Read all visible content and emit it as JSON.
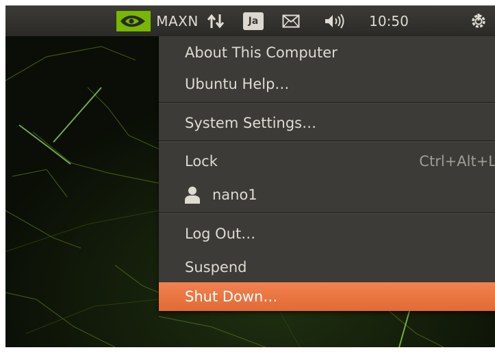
{
  "panel": {
    "nvidia_indicator_icon": "nvidia-logo-icon",
    "power_mode": "MAXN",
    "network_icon": "network-arrows-icon",
    "keyboard_layout": "Ja",
    "mail_icon": "envelope-icon",
    "sound_icon": "speaker-icon",
    "clock": "10:50",
    "session_icon": "gear-power-icon"
  },
  "menu": {
    "about": "About This Computer",
    "help": "Ubuntu Help…",
    "settings": "System Settings…",
    "lock": "Lock",
    "lock_shortcut": "Ctrl+Alt+L",
    "user_icon": "user-icon",
    "user": "nano1",
    "logout": "Log Out…",
    "suspend": "Suspend",
    "shutdown": "Shut Down…"
  },
  "colors": {
    "panel": "#3c3b37",
    "menu_background": "#3c3b37",
    "menu_text": "#dfdbd2",
    "highlight": "#e9743f",
    "nvidia_green": "#76b900",
    "desktop_background": "#0d1208"
  }
}
